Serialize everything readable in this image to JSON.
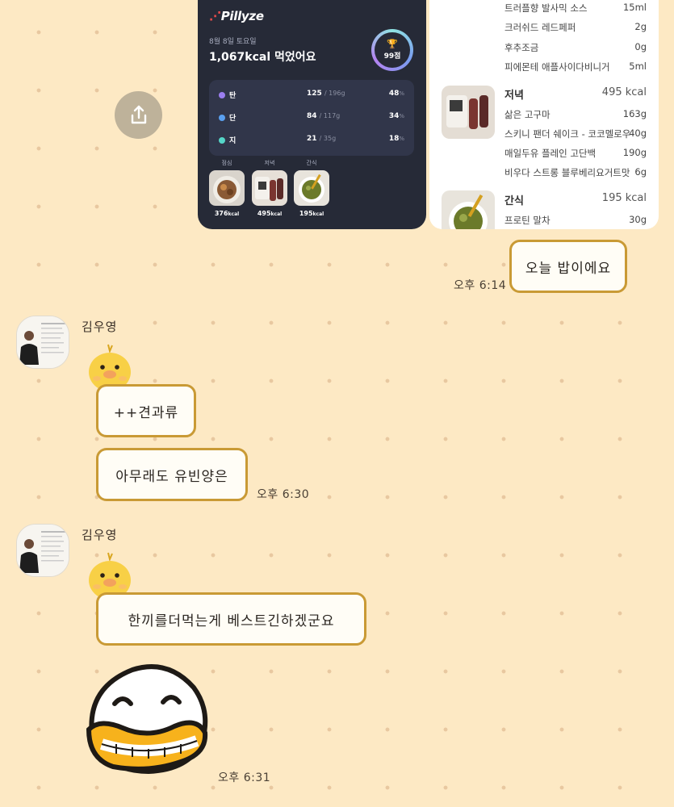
{
  "share": {
    "icon": "share-upload-icon"
  },
  "pillyze": {
    "logo": "Pillyze",
    "date": "8월 8일 토요일",
    "kcal_summary": "1,067kcal 먹었어요",
    "score": "99점",
    "macros": [
      {
        "name": "탄",
        "amount": "125",
        "target": "/ 196g",
        "pct": "48",
        "pct_unit": "%",
        "color": "#9b7ef0"
      },
      {
        "name": "단",
        "amount": "84",
        "target": "/ 117g",
        "pct": "34",
        "pct_unit": "%",
        "color": "#5aa0f0"
      },
      {
        "name": "지",
        "amount": "21",
        "target": "/ 35g",
        "pct": "18",
        "pct_unit": "%",
        "color": "#55d6c8"
      }
    ],
    "meals": [
      {
        "label": "점심",
        "kcal": "376",
        "unit": "kcal"
      },
      {
        "label": "저녁",
        "kcal": "495",
        "unit": "kcal"
      },
      {
        "label": "간식",
        "kcal": "195",
        "unit": "kcal"
      }
    ]
  },
  "food_list": {
    "top_items": [
      {
        "name": "트러플향 발사믹 소스",
        "amount": "15ml"
      },
      {
        "name": "크러쉬드 레드페퍼",
        "amount": "2g"
      },
      {
        "name": "후추조금",
        "amount": "0g"
      },
      {
        "name": "피에몬테 애플사이다비니거",
        "amount": "5ml"
      }
    ],
    "dinner": {
      "title": "저녁",
      "kcal": "495 kcal",
      "items": [
        {
          "name": "삶은 고구마",
          "amount": "163g"
        },
        {
          "name": "스키니 팬더 쉐이크 - 코코멜로우",
          "amount": "40g"
        },
        {
          "name": "매일두유 플레인 고단백",
          "amount": "190g"
        },
        {
          "name": "비우다 스트롱 블루베리요거트맛",
          "amount": "6g"
        }
      ]
    },
    "snack": {
      "title": "간식",
      "kcal": "195 kcal",
      "items": [
        {
          "name": "프로틴 말차",
          "amount": "30g"
        }
      ]
    }
  },
  "messages": {
    "mine": {
      "text": "오늘 밥이에요",
      "time": "오후 6:14"
    },
    "group1": {
      "sender": "김우영",
      "bubbles": [
        "++견과류",
        "아무래도 유빈양은"
      ],
      "time": "오후 6:30"
    },
    "group2": {
      "sender": "김우영",
      "bubbles": [
        "한끼를더먹는게 베스트긴하겠군요"
      ],
      "time": "오후 6:31"
    }
  }
}
